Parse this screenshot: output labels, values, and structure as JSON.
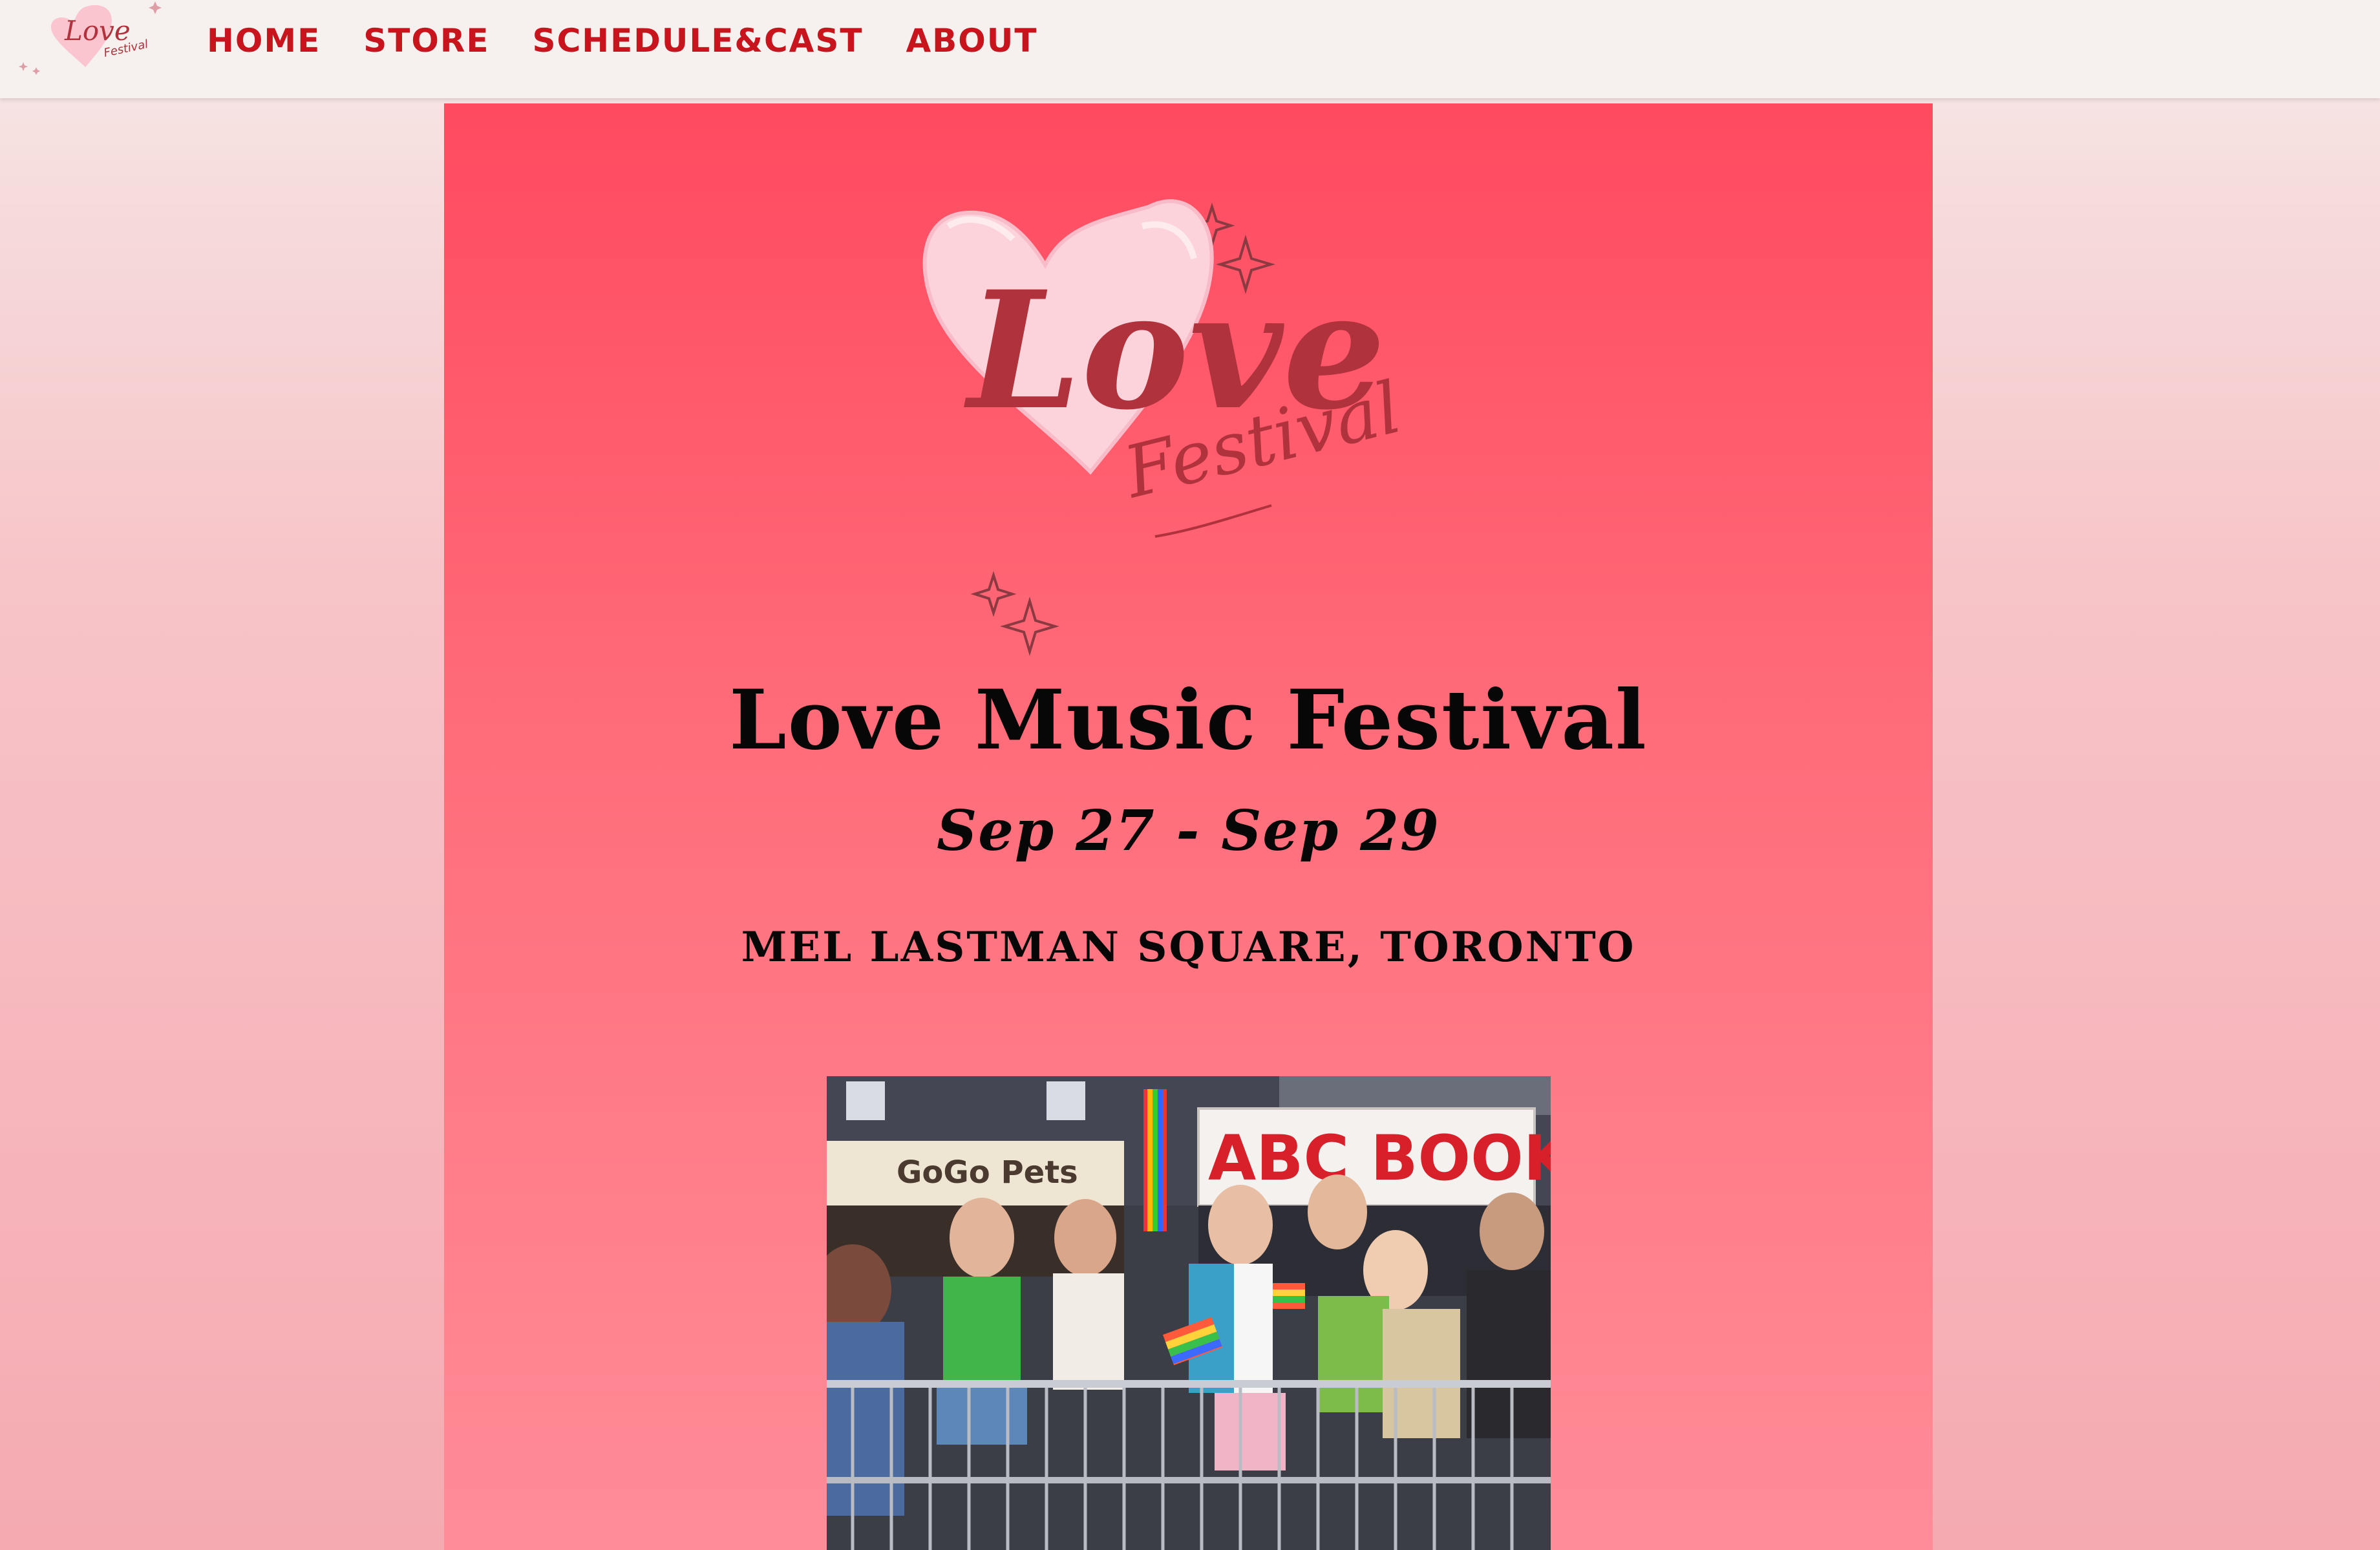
{
  "nav": {
    "logo": {
      "icon": "love-festival-heart-logo",
      "word": "Love",
      "subword": "Festival"
    },
    "links": [
      {
        "label": "HOME"
      },
      {
        "label": "STORE"
      },
      {
        "label": "SCHEDULE&CAST"
      },
      {
        "label": "ABOUT"
      }
    ]
  },
  "hero": {
    "logo": {
      "icon": "love-festival-heart-logo",
      "word": "Love",
      "subword": "Festival"
    },
    "title": "Love Music Festival",
    "dates": "Sep 27 - Sep 29",
    "venue": "MEL LASTMAN SQUARE, TORONTO",
    "photo": {
      "signs": [
        "GoGo Pets",
        "ABC BOOKS"
      ]
    }
  },
  "colors": {
    "nav_bg": "#f6f0ee",
    "nav_link": "#c8141c",
    "hero_top": "#ff4a60",
    "hero_bottom": "#ff8d98",
    "heart_fill": "#fcd3da",
    "logo_text": "#b0323c",
    "text": "#070707"
  }
}
